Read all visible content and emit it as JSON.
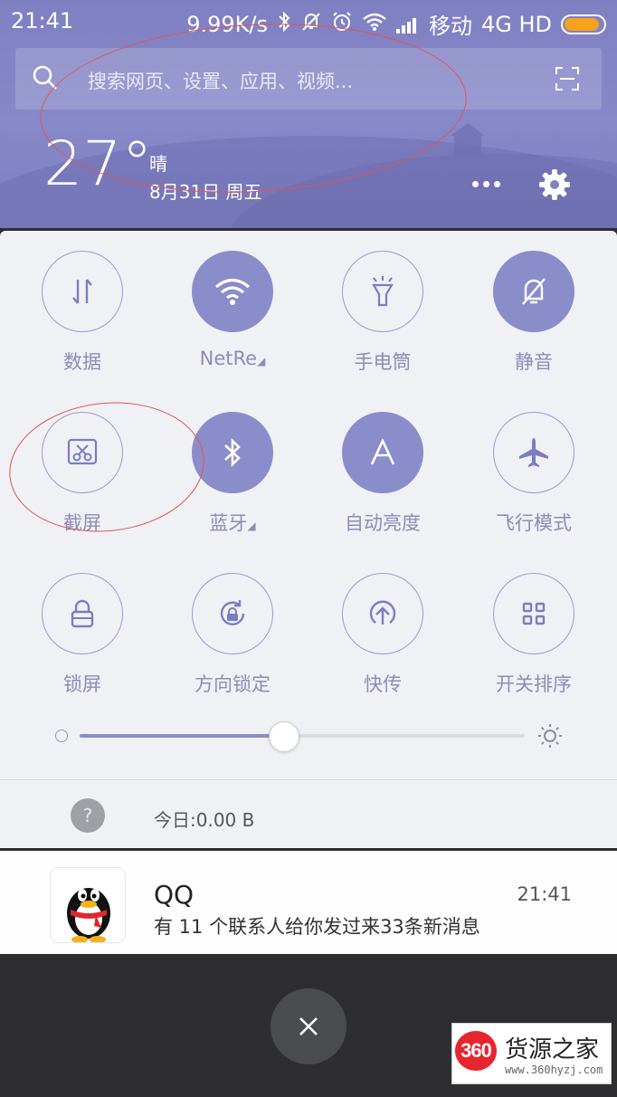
{
  "status_bar": {
    "time": "21:41",
    "network_speed": "9.99K/s",
    "carrier": "移动",
    "network_type": "4G HD",
    "battery_color": "#f6a21a"
  },
  "search": {
    "placeholder": "搜索网页、设置、应用、视频..."
  },
  "weather": {
    "temperature": "27°",
    "condition": "晴",
    "date": "8月31日 周五"
  },
  "quick_settings": {
    "tiles": [
      {
        "label": "数据",
        "icon": "data-transfer-icon",
        "active": false
      },
      {
        "label": "NetRe",
        "icon": "wifi-icon",
        "active": true,
        "has_submenu": true
      },
      {
        "label": "手电筒",
        "icon": "flashlight-icon",
        "active": false
      },
      {
        "label": "静音",
        "icon": "mute-bell-icon",
        "active": true
      },
      {
        "label": "截屏",
        "icon": "screenshot-scissors-icon",
        "active": false
      },
      {
        "label": "蓝牙",
        "icon": "bluetooth-icon",
        "active": true,
        "has_submenu": true
      },
      {
        "label": "自动亮度",
        "icon": "auto-brightness-icon",
        "active": true
      },
      {
        "label": "飞行模式",
        "icon": "airplane-icon",
        "active": false
      },
      {
        "label": "锁屏",
        "icon": "lock-icon",
        "active": false
      },
      {
        "label": "方向锁定",
        "icon": "rotation-lock-icon",
        "active": false
      },
      {
        "label": "快传",
        "icon": "quick-transfer-icon",
        "active": false
      },
      {
        "label": "开关排序",
        "icon": "grid-sort-icon",
        "active": false
      }
    ],
    "submenu_marker": "◢",
    "brightness_level": 0.46,
    "accent_color": "#8b8cca"
  },
  "data_usage": {
    "text": "今日:0.00 B",
    "help_glyph": "?"
  },
  "notification": {
    "app": "QQ",
    "time": "21:41",
    "message": "有 11 个联系人给你发过来33条新消息"
  },
  "watermark": {
    "logo": "360",
    "name": "货源之家",
    "url": "www.360hyzj.com"
  }
}
